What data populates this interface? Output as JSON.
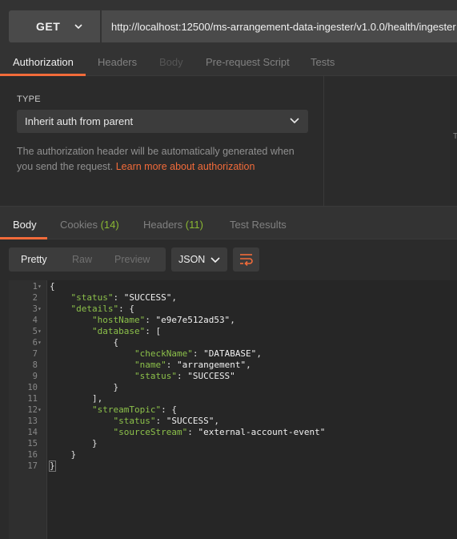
{
  "request": {
    "method": "GET",
    "url": "http://localhost:12500/ms-arrangement-data-ingester/v1.0.0/health/ingester"
  },
  "request_tabs": [
    {
      "label": "Authorization",
      "active": true
    },
    {
      "label": "Headers",
      "active": false
    },
    {
      "label": "Body",
      "active": false,
      "disabled": true
    },
    {
      "label": "Pre-request Script",
      "active": false
    },
    {
      "label": "Tests",
      "active": false
    }
  ],
  "auth": {
    "type_label": "TYPE",
    "type_value": "Inherit auth from parent",
    "description": "The authorization header will be automatically generated when you send the request.",
    "link_text": "Learn more about authorization",
    "edge_char": "T"
  },
  "response_tabs": [
    {
      "label": "Body",
      "count": "",
      "active": true
    },
    {
      "label": "Cookies",
      "count": "(14)",
      "active": false
    },
    {
      "label": "Headers",
      "count": "(11)",
      "active": false
    },
    {
      "label": "Test Results",
      "count": "",
      "active": false
    }
  ],
  "view_modes": [
    {
      "label": "Pretty",
      "active": true
    },
    {
      "label": "Raw",
      "active": false
    },
    {
      "label": "Preview",
      "active": false
    }
  ],
  "format": "JSON",
  "icons": {
    "method_dropdown": "chevron-down-icon",
    "type_dropdown": "chevron-down-icon",
    "format_dropdown": "chevron-down-icon",
    "wrap": "wrap-lines-icon",
    "fold": "fold-arrow-icon"
  },
  "colors": {
    "accent": "#f26b3a",
    "json_key": "#8cc04a",
    "count_green": "#8ab833"
  },
  "code_lines": [
    {
      "num": "1",
      "fold": true,
      "text": "{"
    },
    {
      "num": "2",
      "fold": false,
      "text": "    \"status\": \"SUCCESS\","
    },
    {
      "num": "3",
      "fold": true,
      "text": "    \"details\": {"
    },
    {
      "num": "4",
      "fold": false,
      "text": "        \"hostName\": \"e9e7e512ad53\","
    },
    {
      "num": "5",
      "fold": true,
      "text": "        \"database\": ["
    },
    {
      "num": "6",
      "fold": true,
      "text": "            {"
    },
    {
      "num": "7",
      "fold": false,
      "text": "                \"checkName\": \"DATABASE\","
    },
    {
      "num": "8",
      "fold": false,
      "text": "                \"name\": \"arrangement\","
    },
    {
      "num": "9",
      "fold": false,
      "text": "                \"status\": \"SUCCESS\""
    },
    {
      "num": "10",
      "fold": false,
      "text": "            }"
    },
    {
      "num": "11",
      "fold": false,
      "text": "        ],"
    },
    {
      "num": "12",
      "fold": true,
      "text": "        \"streamTopic\": {"
    },
    {
      "num": "13",
      "fold": false,
      "text": "            \"status\": \"SUCCESS\","
    },
    {
      "num": "14",
      "fold": false,
      "text": "            \"sourceStream\": \"external-account-event\""
    },
    {
      "num": "15",
      "fold": false,
      "text": "        }"
    },
    {
      "num": "16",
      "fold": false,
      "text": "    }"
    },
    {
      "num": "17",
      "fold": false,
      "text": "}"
    }
  ]
}
